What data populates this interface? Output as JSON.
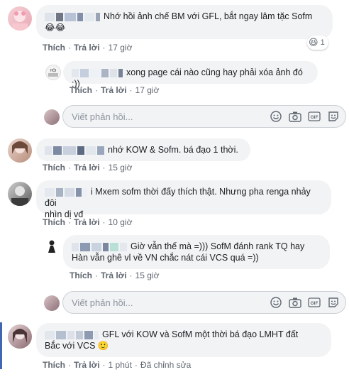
{
  "comments": [
    {
      "text": "Nhớ hồi ảnh chế BM với GFL, bắt ngay lâm tặc Sofm",
      "emoji": "😂😂",
      "actions": {
        "like": "Thích",
        "reply": "Trả lời",
        "time": "17 giờ"
      },
      "reaction_count": "1"
    },
    {
      "text": "xong page cái nào cũng hay phải xóa ảnh đó :))",
      "actions": {
        "like": "Thích",
        "reply": "Trả lời",
        "time": "17 giờ"
      }
    },
    {
      "text": "nhớ KOW & Sofm. bá đạo 1 thời.",
      "actions": {
        "like": "Thích",
        "reply": "Trả lời",
        "time": "15 giờ"
      }
    },
    {
      "line1": "i Mxem sofm thời đấy thích thật. Nhưng pha renga nhảy đôi",
      "line2": "nhìn dị vđ",
      "actions": {
        "like": "Thích",
        "reply": "Trả lời",
        "time": "10 giờ"
      }
    },
    {
      "line1": "Giờ vẫn thế mà =))) SofM đánh rank TQ hay",
      "line2": "Hàn vẫn ghê vl về VN chắc nát cái VCS quá =))",
      "actions": {
        "like": "Thích",
        "reply": "Trả lời",
        "time": "15 giờ"
      }
    },
    {
      "line1": "GFL với KOW và SofM một thời bá đạo LMHT đất",
      "line2": "Bắc với VCS",
      "emoji": "🙂",
      "actions": {
        "like": "Thích",
        "reply": "Trả lời",
        "time": "1 phút",
        "edit": "Đã chỉnh sửa"
      }
    }
  ],
  "reply_box": {
    "placeholder": "Viết phản hồi..."
  },
  "colors": {
    "bubble": "#f2f3f5",
    "meta": "#606770",
    "border": "#ccd0d5"
  },
  "icons": [
    "emoji-icon",
    "camera-icon",
    "gif-icon",
    "sticker-icon"
  ]
}
